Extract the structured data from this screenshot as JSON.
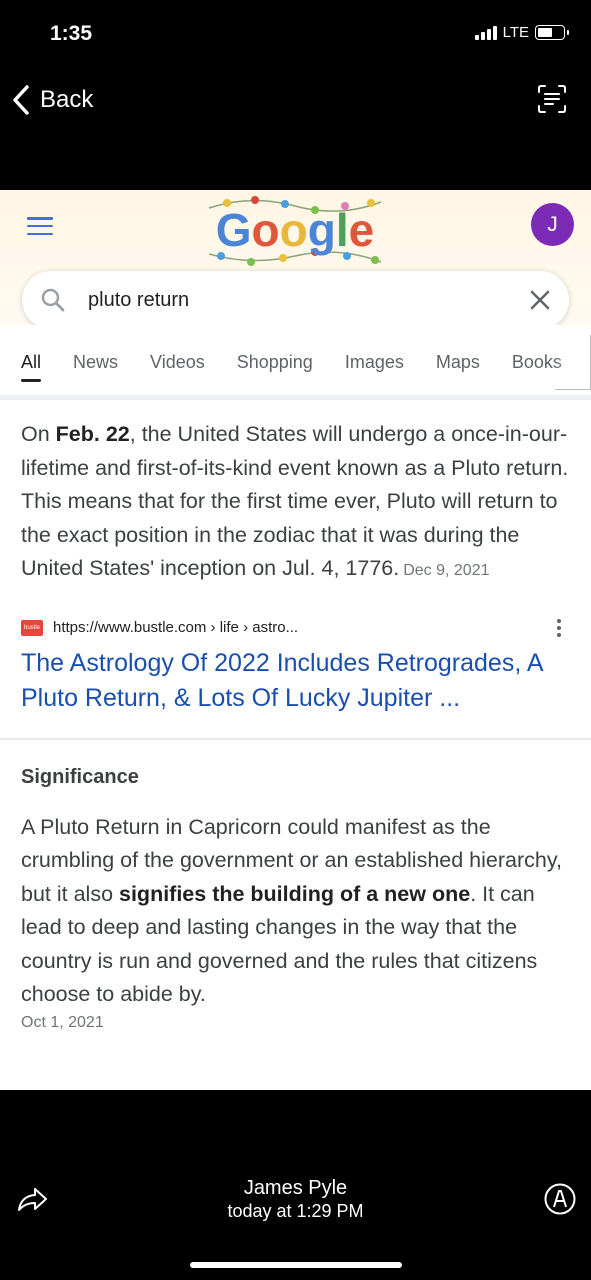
{
  "status_bar": {
    "time": "1:35",
    "network": "LTE"
  },
  "viewer": {
    "back_label": "Back",
    "sender_name": "James Pyle",
    "sender_time": "today at 1:29 PM"
  },
  "google": {
    "logo_text": "Google",
    "avatar_letter": "J",
    "search_query": "pluto return",
    "tabs": [
      "All",
      "News",
      "Videos",
      "Shopping",
      "Images",
      "Maps",
      "Books"
    ],
    "active_tab": "All"
  },
  "snippet": {
    "part1": "On ",
    "bold": "Feb. 22",
    "part2": ", the United States will undergo a once-in-our-lifetime and first-of-its-kind event known as a Pluto return. This means that for the first time ever, Pluto will return to the exact position in the zodiac that it was during the United States' inception on Jul. 4, 1776.",
    "date": "Dec 9, 2021"
  },
  "result": {
    "favicon_text": "bustle",
    "url": "https://www.bustle.com › life › astro...",
    "title": "The Astrology Of 2022 Includes Retrogrades, A Pluto Return, & Lots Of Lucky Jupiter ..."
  },
  "significance": {
    "heading": "Significance",
    "part1": "A Pluto Return in Capricorn could manifest as the crumbling of the government or an established hierarchy, but it also ",
    "bold": "signifies the building of a new one",
    "part2": ". It can lead to deep and lasting changes in the way that the country is run and governed and the rules that citizens choose to abide by.",
    "date": "Oct 1, 2021"
  },
  "colors": {
    "link_blue": "#1a4fb0",
    "avatar_purple": "#7b2bb5",
    "header_bg": "#fff6e4"
  }
}
